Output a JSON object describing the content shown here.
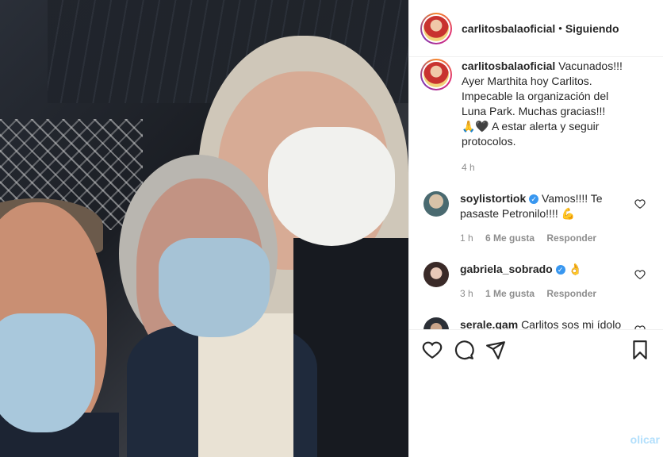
{
  "header": {
    "username": "carlitosbalaoficial",
    "separator": "•",
    "follow_status": "Siguiendo"
  },
  "caption": {
    "username": "carlitosbalaoficial",
    "text_line1": "Vacunados!!! Ayer Marthita hoy Carlitos. Impecable la organización del Luna Park. Muchas gracias!!!",
    "text_line2": "🙏🖤 A estar alerta y seguir protocolos.",
    "time": "4 h"
  },
  "comments": [
    {
      "username": "soylistortiok",
      "verified": true,
      "text": "Vamos!!!! Te pasaste Petronilo!!!! 💪",
      "time": "1 h",
      "likes": "6 Me gusta",
      "reply": "Responder"
    },
    {
      "username": "gabriela_sobrado",
      "verified": true,
      "text": "👌",
      "time": "3 h",
      "likes": "1 Me gusta",
      "reply": "Responder"
    },
    {
      "username": "serale.gam",
      "verified": false,
      "text": "Carlitos sos mi ídolo"
    }
  ],
  "footer": {
    "publish_partial": "olicar"
  },
  "icons": {
    "like": "heart-icon",
    "comment": "comment-icon",
    "share": "share-icon",
    "save": "bookmark-icon"
  },
  "colors": {
    "verified": "#3897f0",
    "muted": "#8e8e8e",
    "text": "#262626"
  }
}
